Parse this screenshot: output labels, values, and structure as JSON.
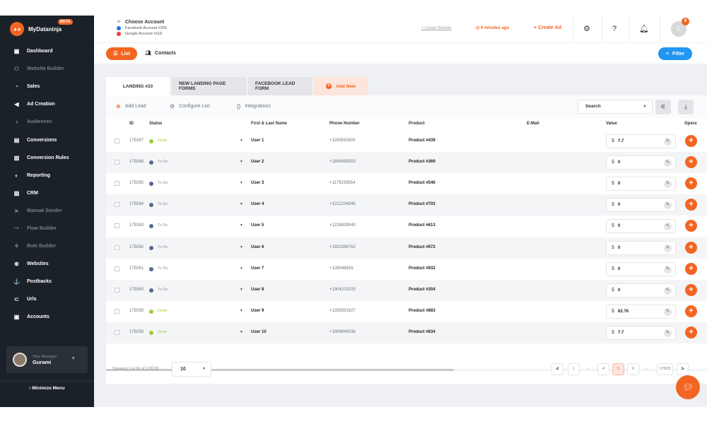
{
  "sidebar": {
    "brand_name": "MyDataninja",
    "brand_badge": "BETA",
    "items": [
      {
        "label": "Dashboard",
        "icon": "dashboard-icon",
        "dim": false
      },
      {
        "label": "Website Builder",
        "icon": "website-builder-icon",
        "dim": true
      },
      {
        "label": "Sales",
        "icon": "sales-icon",
        "dim": false
      },
      {
        "label": "Ad Creation",
        "icon": "megaphone-icon",
        "dim": false
      },
      {
        "label": "Audiences",
        "icon": "audiences-icon",
        "dim": true
      },
      {
        "label": "Conversions",
        "icon": "conversions-icon",
        "dim": false
      },
      {
        "label": "Conversion Rules",
        "icon": "conversion-rules-icon",
        "dim": false
      },
      {
        "label": "Reporting",
        "icon": "reporting-icon",
        "dim": false
      },
      {
        "label": "CRM",
        "icon": "crm-icon",
        "dim": false
      },
      {
        "label": "Manual Sender",
        "icon": "send-icon",
        "dim": true
      },
      {
        "label": "Flow Builder",
        "icon": "flow-icon",
        "dim": true
      },
      {
        "label": "Rule Builder",
        "icon": "rule-icon",
        "dim": true
      },
      {
        "label": "Websites",
        "icon": "globe-icon",
        "dim": false
      },
      {
        "label": "Postbacks",
        "icon": "anchor-icon",
        "dim": false
      },
      {
        "label": "Urls",
        "icon": "link-icon",
        "dim": false
      },
      {
        "label": "Accounts",
        "icon": "accounts-icon",
        "dim": false
      }
    ],
    "manager_label": "Your Manager",
    "manager_name": "Gurami",
    "minimize_label": "Minimize Menu"
  },
  "topbar": {
    "account_title": "Choose Account",
    "facebook_account": "Facebook Account #205",
    "google_account": "Google Account #119",
    "create_website": "+ Create Website",
    "time_ago": "9 minutes ago",
    "create_ad": "+ Create Ad",
    "help": "?",
    "avatar_letter": "C",
    "notification_count": "9"
  },
  "subbar": {
    "list_label": "List",
    "contacts_label": "Contacts",
    "filter_label": "Filter"
  },
  "tabs": [
    "LANDING #33",
    "NEW LANDING PAGE FORMS",
    "FACEBOOK LEAD FORM"
  ],
  "add_tab_label": "Add New",
  "toolbar": {
    "add_lead": "Add Lead",
    "configure_list": "Configure List",
    "integrations": "Integrations",
    "search_placeholder": "Search"
  },
  "table": {
    "headers": [
      "ID",
      "Status",
      "First & Last Name",
      "Phone Number",
      "Product",
      "E-Mail",
      "Value",
      "Opera"
    ],
    "currency": "$",
    "rows": [
      {
        "id": "179267",
        "status": "Done",
        "name": "User 1",
        "phone": "+1163932603",
        "product": "Product #439",
        "email": "",
        "value": "7.7"
      },
      {
        "id": "179266",
        "status": "To Do",
        "name": "User 2",
        "phone": "+1849089353",
        "product": "Product #369",
        "email": "",
        "value": "0"
      },
      {
        "id": "179265",
        "status": "To Do",
        "name": "User 3",
        "phone": "+1179233654",
        "product": "Product #546",
        "email": "",
        "value": "0"
      },
      {
        "id": "179264",
        "status": "To Do",
        "name": "User 4",
        "phone": "+1212234945",
        "product": "Product #703",
        "email": "",
        "value": "0"
      },
      {
        "id": "179263",
        "status": "To Do",
        "name": "User 5",
        "phone": "+1228839040",
        "product": "Product #613",
        "email": "",
        "value": "0"
      },
      {
        "id": "179262",
        "status": "To Do",
        "name": "User 6",
        "phone": "+1920286762",
        "product": "Product #972",
        "email": "",
        "value": "0"
      },
      {
        "id": "179261",
        "status": "To Do",
        "name": "User 7",
        "phone": "+128548816",
        "product": "Product #932",
        "email": "",
        "value": "0"
      },
      {
        "id": "179260",
        "status": "To Do",
        "name": "User 8",
        "phone": "+1904101020",
        "product": "Product #304",
        "email": "",
        "value": "0"
      },
      {
        "id": "179259",
        "status": "Done",
        "name": "User 9",
        "phone": "+1339591827",
        "product": "Product #883",
        "email": "",
        "value": "62.76"
      },
      {
        "id": "179258",
        "status": "Done",
        "name": "User 10",
        "phone": "+1909845036",
        "product": "Product #834",
        "email": "",
        "value": "7.7"
      }
    ]
  },
  "footer": {
    "showing": "Showing 1 to 50 of 178228",
    "page_size": "10",
    "pages": [
      "<",
      "1",
      "...",
      "4",
      "5",
      "6",
      "...",
      "17823",
      ">"
    ],
    "active_page": "5"
  },
  "colors": {
    "accent": "#f26522",
    "filter": "#2196f3",
    "done": "#9ccc3c",
    "todo": "#556a8c",
    "sidebar_bg": "#1b2128"
  }
}
